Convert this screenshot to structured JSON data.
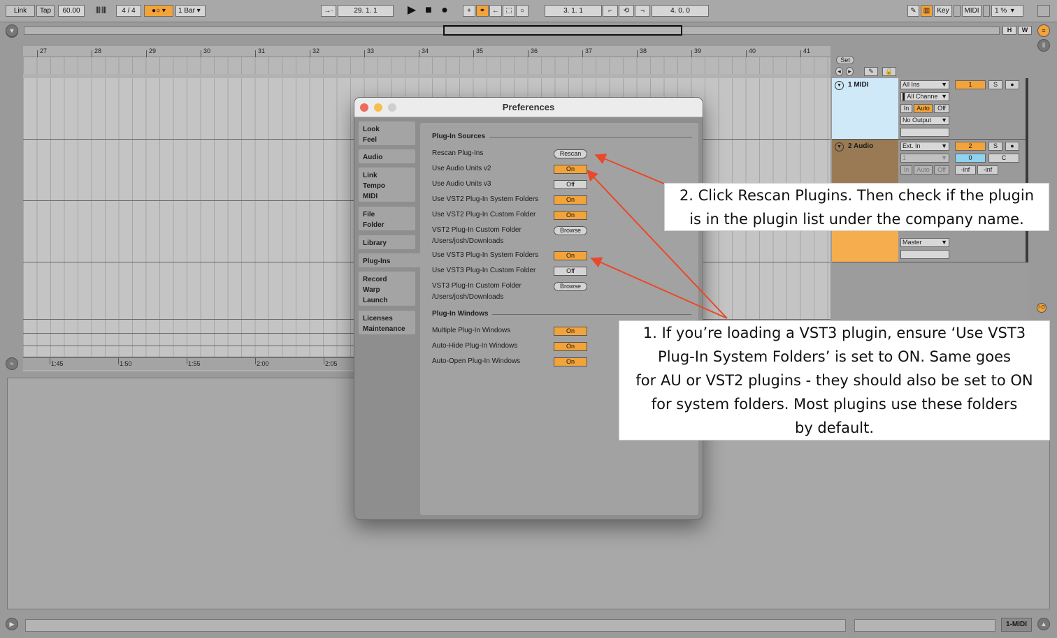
{
  "transport": {
    "link": "Link",
    "tap": "Tap",
    "tempo": "60.00",
    "time_sig": "4 / 4",
    "quantize": "1 Bar",
    "arr_position": "29.  1.  1",
    "loop_start": "3.  1.  1",
    "loop_length": "4.  0.  0",
    "key": "Key",
    "midi": "MIDI",
    "cpu": "1 %"
  },
  "overview": {
    "h": "H",
    "w": "W"
  },
  "ruler": {
    "bars": [
      "27",
      "28",
      "29",
      "30",
      "31",
      "32",
      "33",
      "34",
      "35",
      "36",
      "37",
      "38",
      "39",
      "40",
      "41"
    ]
  },
  "timeline": {
    "times": [
      "1:45",
      "1:50",
      "1:55",
      "2:00",
      "2:05"
    ]
  },
  "set_button": "Set",
  "tracks": [
    {
      "name": "1 MIDI",
      "input": "All Ins",
      "channel": "All Channe",
      "monitor": [
        "In",
        "Auto",
        "Off"
      ],
      "output": "No Output",
      "number": "1",
      "solo": "S",
      "color": "#cfe9f8"
    },
    {
      "name": "2 Audio",
      "input": "Ext. In",
      "channel": "1",
      "monitor": [
        "In",
        "Auto",
        "Off"
      ],
      "output": "Master",
      "number": "2",
      "solo": "S",
      "volume": "0",
      "pan": "C",
      "meters": [
        "-inf",
        "-inf"
      ],
      "color": "#9a7a55"
    }
  ],
  "track3": {
    "output": "Master",
    "color": "#f5ad4d"
  },
  "status": {
    "track": "1-MIDI"
  },
  "preferences": {
    "title": "Preferences",
    "tabs": [
      "Look\nFeel",
      "Audio",
      "Link\nTempo\nMIDI",
      "File\nFolder",
      "Library",
      "Plug-Ins",
      "Record\nWarp\nLaunch",
      "Licenses\nMaintenance"
    ],
    "active_tab": "Plug-Ins",
    "sources_header": "Plug-In Sources",
    "windows_header": "Plug-In Windows",
    "rows": {
      "rescan": {
        "label": "Rescan Plug-Ins",
        "button": "Rescan"
      },
      "au_v2": {
        "label": "Use Audio Units v2",
        "value": "On"
      },
      "au_v3": {
        "label": "Use Audio Units v3",
        "value": "Off"
      },
      "vst2_sys": {
        "label": "Use VST2 Plug-In System Folders",
        "value": "On"
      },
      "vst2_custom": {
        "label": "Use VST2 Plug-In Custom Folder",
        "value": "On"
      },
      "vst2_folder": {
        "label": "VST2 Plug-In Custom Folder",
        "path": "/Users/josh/Downloads",
        "button": "Browse"
      },
      "vst3_sys": {
        "label": "Use VST3 Plug-In System Folders",
        "value": "On"
      },
      "vst3_custom": {
        "label": "Use VST3 Plug-In Custom Folder",
        "value": "Off"
      },
      "vst3_folder": {
        "label": "VST3 Plug-In Custom Folder",
        "path": "/Users/josh/Downloads",
        "button": "Browse"
      },
      "multi_win": {
        "label": "Multiple Plug-In Windows",
        "value": "On"
      },
      "auto_hide": {
        "label": "Auto-Hide Plug-In Windows",
        "value": "On"
      },
      "auto_open": {
        "label": "Auto-Open Plug-In Windows",
        "value": "On"
      }
    }
  },
  "annotations": {
    "step2": [
      "2. Click Rescan Plugins. Then check if the plugin",
      "is in the plugin list under the company name."
    ],
    "step1": [
      "1. If you’re loading a VST3 plugin, ensure ‘Use VST3",
      "Plug-In System Folders’ is set to ON. Same goes",
      "for AU or VST2 plugins - they should also be set to ON",
      "for system folders. Most plugins use these folders",
      "by default."
    ],
    "arrow_color": "#e8492a"
  }
}
